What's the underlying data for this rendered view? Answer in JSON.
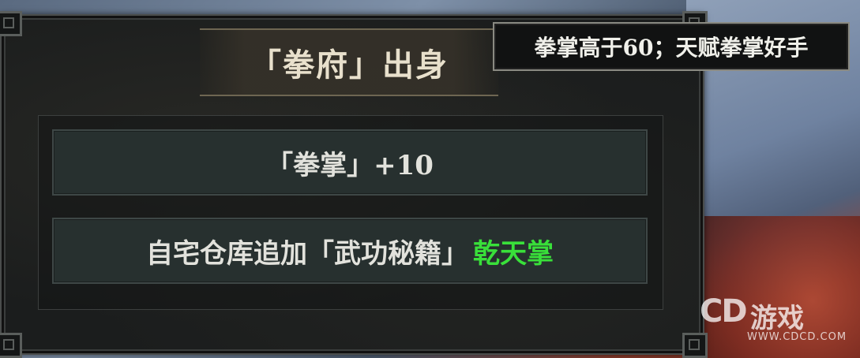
{
  "panel": {
    "title": "「拳府」出身",
    "rows": [
      {
        "text": "「拳掌」+10",
        "highlight": ""
      },
      {
        "text": "自宅仓库追加「武功秘籍」",
        "highlight": "乾天掌"
      }
    ]
  },
  "tooltip": {
    "text": "拳掌高于60；天赋拳掌好手"
  },
  "watermark": {
    "logo": "CD",
    "name": "游戏",
    "url": "WWW.CDCD.COM"
  },
  "colors": {
    "highlight": "#39e03a",
    "panel_bg": "#1b1d1d",
    "row_bg": "#27302f"
  }
}
